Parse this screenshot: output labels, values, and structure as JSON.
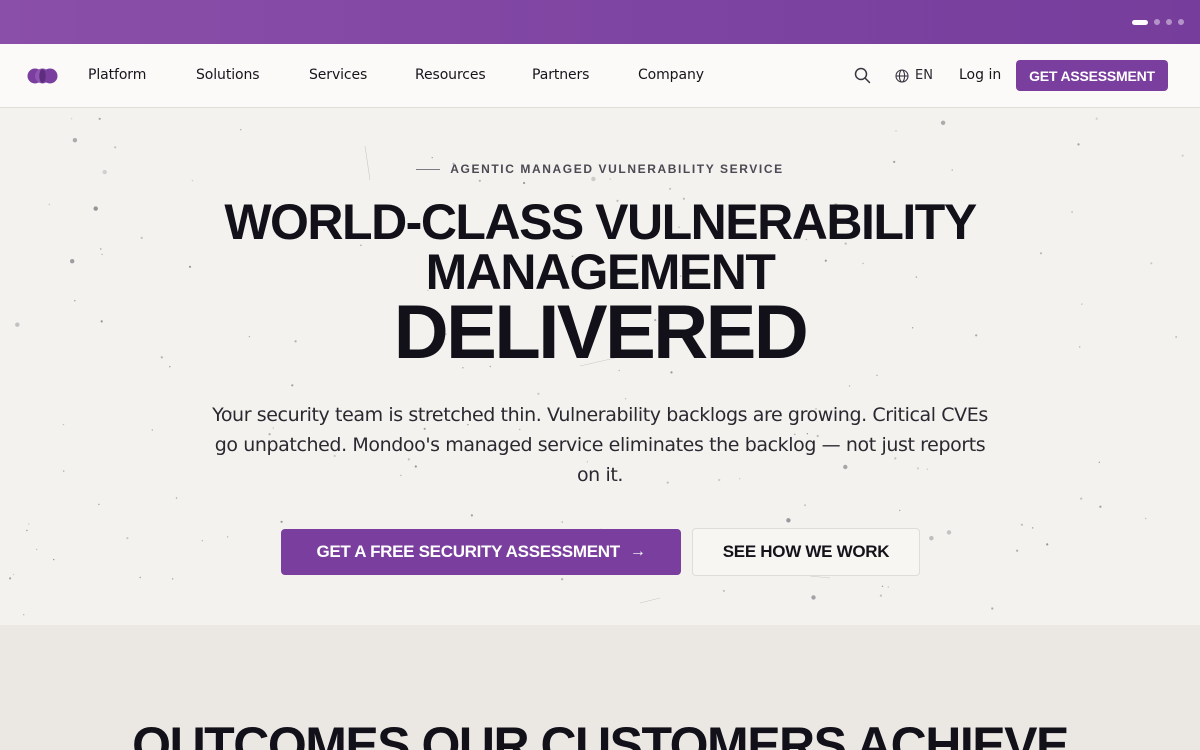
{
  "announcement_bar": {
    "carousel_slides": 4,
    "active_slide": 1,
    "colors": {
      "bar": "#7f45a2",
      "dot_active": "#ffffff"
    }
  },
  "nav": {
    "logo_icon": "mondoo-logo-icon",
    "items": [
      "Platform",
      "Solutions",
      "Services",
      "Resources",
      "Partners",
      "Company"
    ],
    "search_icon": "search-icon",
    "language": {
      "icon": "globe-icon",
      "label": "EN"
    },
    "login_label": "Log in",
    "cta_label": "GET ASSESSMENT"
  },
  "hero": {
    "eyebrow": "AGENTIC MANAGED VULNERABILITY SERVICE",
    "headline_line1": "WORLD-CLASS VULNERABILITY",
    "headline_line2": "MANAGEMENT",
    "headline_line3": "DELIVERED",
    "lead": "Your security team is stretched thin. Vulnerability backlogs are growing. Critical CVEs go unpatched. Mondoo's managed service eliminates the backlog — not just reports on it.",
    "primary_cta": "GET A FREE SECURITY ASSESSMENT",
    "primary_cta_icon": "arrow-right-icon",
    "secondary_cta": "SEE HOW WE WORK"
  },
  "outcomes": {
    "title": "OUTCOMES OUR CUSTOMERS ACHIEVE"
  },
  "colors": {
    "brand_purple": "#7a3f9e",
    "hero_bg": "#f3f2ef",
    "text_dark": "#121018"
  }
}
